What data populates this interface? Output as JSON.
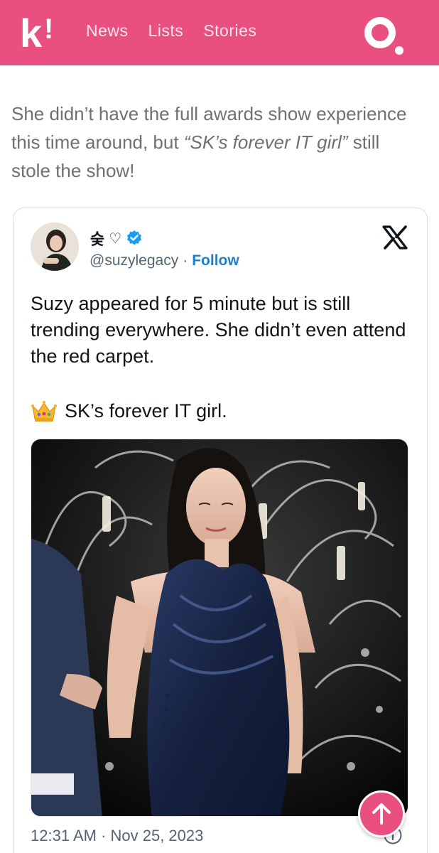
{
  "header": {
    "nav": [
      "News",
      "Lists",
      "Stories"
    ]
  },
  "article": {
    "lead_part1": "She didn’t have the full awards show experience this time around, but ",
    "lead_quote": "“SK’s forever IT girl”",
    "lead_part2": " still stole the show!"
  },
  "tweet": {
    "name": "숮",
    "handle": "@suzylegacy",
    "separator": "·",
    "follow_label": "Follow",
    "text": "Suzy appeared for 5 minute but is still trending everywhere. She didn’t even attend the red carpet.",
    "crown_text": "SK’s forever IT girl.",
    "timestamp": "12:31 AM · Nov 25, 2023"
  },
  "colors": {
    "brand": "#e9507f",
    "follow": "#1d7fd0",
    "verified": "#1d9bf0"
  }
}
